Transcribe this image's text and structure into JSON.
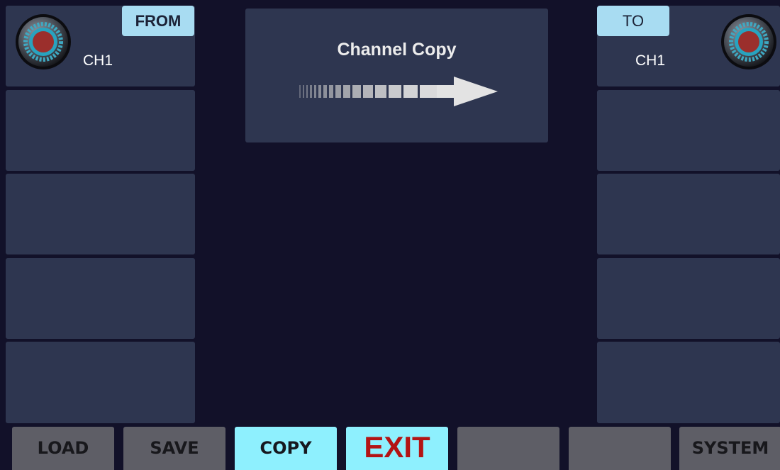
{
  "source_panel": {
    "tag": "FROM",
    "channel": "CH1",
    "knob_icon": "rotary-knob-icon"
  },
  "target_panel": {
    "tag": "TO",
    "channel": "CH1",
    "knob_icon": "rotary-knob-icon"
  },
  "copy_panel": {
    "title": "Channel Copy",
    "arrow_icon": "right-arrow-icon"
  },
  "function_keys": {
    "load": "LOAD",
    "save": "SAVE",
    "copy": "COPY",
    "exit": "EXIT",
    "f5": "",
    "f6": "",
    "system": "SYSTEM"
  },
  "colors": {
    "background": "#121129",
    "slot": "#2e3650",
    "tag": "#a8dcf2",
    "active_key": "#8ef0fe",
    "inactive_key": "#5e5e66",
    "exit_text": "#b31414"
  }
}
